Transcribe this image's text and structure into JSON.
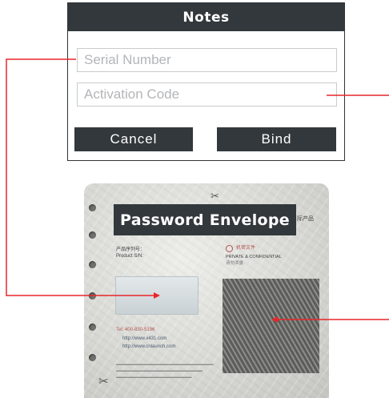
{
  "dialog": {
    "title": "Notes",
    "serial_placeholder": "Serial Number",
    "activation_placeholder": "Activation Code",
    "cancel_label": "Cancel",
    "bind_label": "Bind"
  },
  "envelope": {
    "title": "Password Envelope",
    "fine_print": {
      "header_tail": "际产品",
      "product_sn_cn": "产品序列号：",
      "product_sn_en": "Product S/N:",
      "brand_cn": "机密文件",
      "confidential": "PRIVATE & CONFIDENTIAL",
      "note_cn": "请勿泄露",
      "phone": "Tel: 400-830-5196",
      "web1": "http://www.x431.com",
      "web2": "http://www.cnlaunch.com"
    }
  },
  "colors": {
    "header_bg": "#33383c",
    "callout_red": "#e8262b",
    "field_border": "#c9cbcd",
    "placeholder": "#b3b5b8"
  }
}
